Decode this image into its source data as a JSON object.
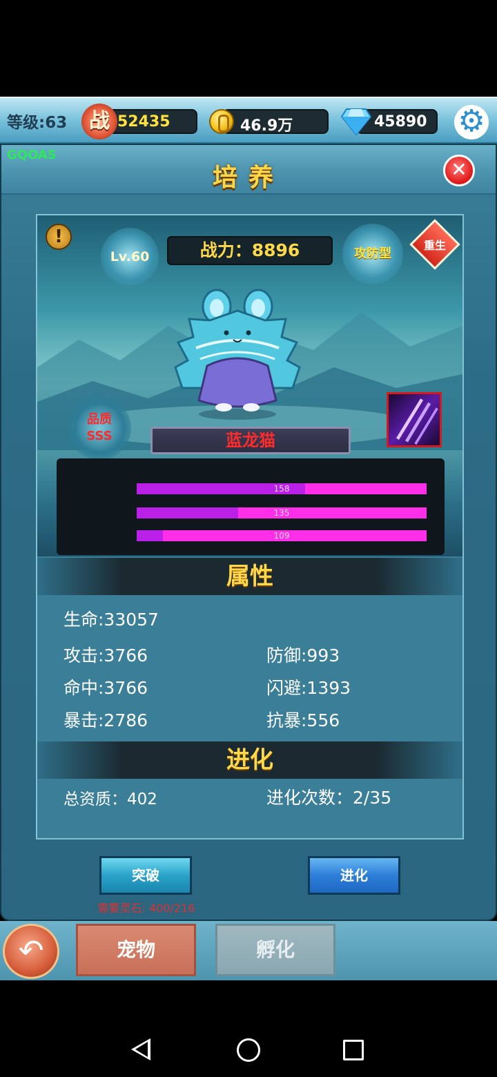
{
  "topbar": {
    "level_label": "等级:63",
    "battle_icon": "战",
    "battle_value": "52435",
    "gold_value": "46.9万",
    "diamond_value": "45890",
    "icons": [
      "battle-power-icon",
      "gold-coin-icon",
      "diamond-icon",
      "gear-icon"
    ]
  },
  "panel": {
    "tag": "GQOAS",
    "title": "培养",
    "close_icon": "close-icon"
  },
  "pet": {
    "level": "Lv.60",
    "power": "战力：8896",
    "type": "攻防型",
    "rebirth": "重生",
    "warning_icon": "!",
    "quality_label": "品质",
    "quality_value": "SSS",
    "name": "蓝龙猫",
    "bars": [
      {
        "value": "158",
        "fill": 0.58
      },
      {
        "value": "135",
        "fill": 0.35
      },
      {
        "value": "109",
        "fill": 0.09
      }
    ]
  },
  "attributes": {
    "header": "属性",
    "hp": "生命:33057",
    "attack": "攻击:3766",
    "defense": "防御:993",
    "hit": "命中:3766",
    "dodge": "闪避:1393",
    "crit": "暴击:2786",
    "anti_crit": "抗暴:556"
  },
  "evolution": {
    "header": "进化",
    "total_aptitude": "总资质：402",
    "evolve_count": "进化次数：2/35"
  },
  "actions": {
    "breakthrough": "突破",
    "evolve": "进化",
    "requirement": "需要灵石: 400/216"
  },
  "bottom_nav": {
    "back_icon": "↶",
    "tab_pet": "宠物",
    "tab_hatch": "孵化"
  },
  "colors": {
    "title_gold": "#ffd84a",
    "quality_red": "#ff2a2a",
    "bar_magenta": "#ff2ee8"
  }
}
